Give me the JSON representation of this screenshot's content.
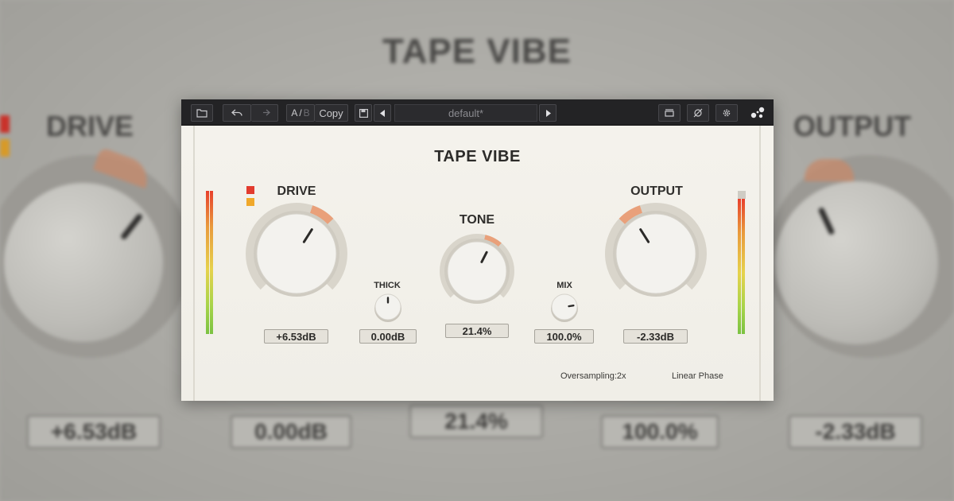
{
  "plugin": {
    "title": "TAPE VIBE"
  },
  "toolbar": {
    "ab_a": "A",
    "ab_sep": "/",
    "ab_b": "B",
    "copy_label": "Copy",
    "preset_name": "default*",
    "icons": [
      "folder-icon",
      "undo-icon",
      "redo-icon",
      "save-icon",
      "prev-preset-icon",
      "next-preset-icon",
      "window-icon",
      "bypass-icon",
      "gear-icon",
      "logo-icon"
    ]
  },
  "controls": {
    "drive": {
      "label": "DRIVE",
      "value": "+6.53dB",
      "level": 0.62
    },
    "thick": {
      "label": "THICK",
      "value": "0.00dB",
      "level": 0.5
    },
    "tone": {
      "label": "TONE",
      "value": "21.4%",
      "level": 0.6
    },
    "mix": {
      "label": "MIX",
      "value": "100.0%",
      "level": 0.8
    },
    "output": {
      "label": "OUTPUT",
      "value": "-2.33dB",
      "level": 0.38
    }
  },
  "footer": {
    "oversampling": "Oversampling:2x",
    "phase": "Linear Phase"
  },
  "colors": {
    "accent": "#e9a07a",
    "led_red": "#e23b2e",
    "led_orange": "#f0a82a",
    "toolbar": "#232325",
    "panel": "#f2f0ea"
  }
}
